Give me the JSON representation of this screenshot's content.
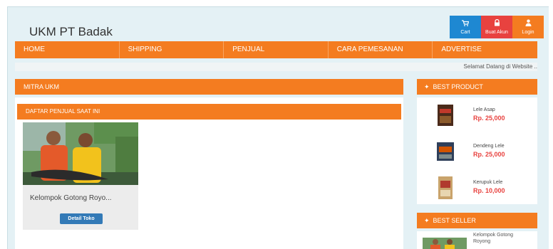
{
  "header": {
    "title": "UKM PT Badak",
    "buttons": [
      {
        "label": "Cart",
        "icon": "cart-icon",
        "color": "#1e88d2"
      },
      {
        "label": "Buat Akun",
        "icon": "lock-icon",
        "color": "#e8423f"
      },
      {
        "label": "Login",
        "icon": "user-icon",
        "color": "#f47c20"
      }
    ]
  },
  "nav": {
    "items": [
      "HOME",
      "SHIPPING",
      "PENJUAL",
      "CARA PEMESANAN",
      "ADVERTISE"
    ]
  },
  "marquee": "Selamat Datang di Website ..",
  "main": {
    "section_title": "MITRA UKM",
    "subsection_title": "DAFTAR PENJUAL SAAT INI",
    "card": {
      "name": "Kelompok Gotong Royo...",
      "button_label": "Detail Toko"
    }
  },
  "sidebar": {
    "best_product": {
      "title": "BEST PRODUCT",
      "icon": "tags-icon",
      "items": [
        {
          "name": "Lele Asap",
          "price": "Rp. 25,000"
        },
        {
          "name": "Dendeng Lele",
          "price": "Rp. 25,000"
        },
        {
          "name": "Kerupuk Lele",
          "price": "Rp. 10,000"
        }
      ]
    },
    "best_seller": {
      "title": "BEST SELLER",
      "icon": "tags-icon",
      "item": {
        "name": "Kelompok Gotong Royong"
      }
    }
  },
  "colors": {
    "accent": "#f47c20",
    "cart": "#1e88d2",
    "akun": "#e8423f",
    "price": "#e8423f",
    "detail_button": "#337ab7"
  }
}
